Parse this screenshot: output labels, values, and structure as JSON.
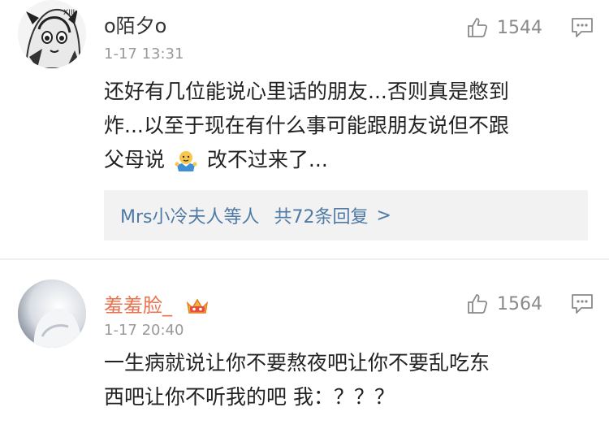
{
  "comments": [
    {
      "username": "o陌夕o",
      "time": "1-17 13:31",
      "likes": "1544",
      "text_line1": "还好有几位能说心里话的朋友...否则真是憋到",
      "text_line2": "炸...以至于现在有什么事可能跟朋友说但不跟",
      "text_line3_a": "父母说",
      "text_line3_b": "改不过来了...",
      "replies_user": "Mrs小冷夫人等人",
      "replies_count": "共72条回复",
      "replies_arrow": ">"
    },
    {
      "username": "羞羞脸_",
      "time": "1-17 20:40",
      "likes": "1564",
      "text_line1": "一生病就说让你不要熬夜吧让你不要乱吃东",
      "text_line2": "西吧让你不听我的吧 我：？？？"
    }
  ],
  "colors": {
    "username2": "#eb7350",
    "link": "#4f7aa5",
    "muted": "#999999"
  }
}
